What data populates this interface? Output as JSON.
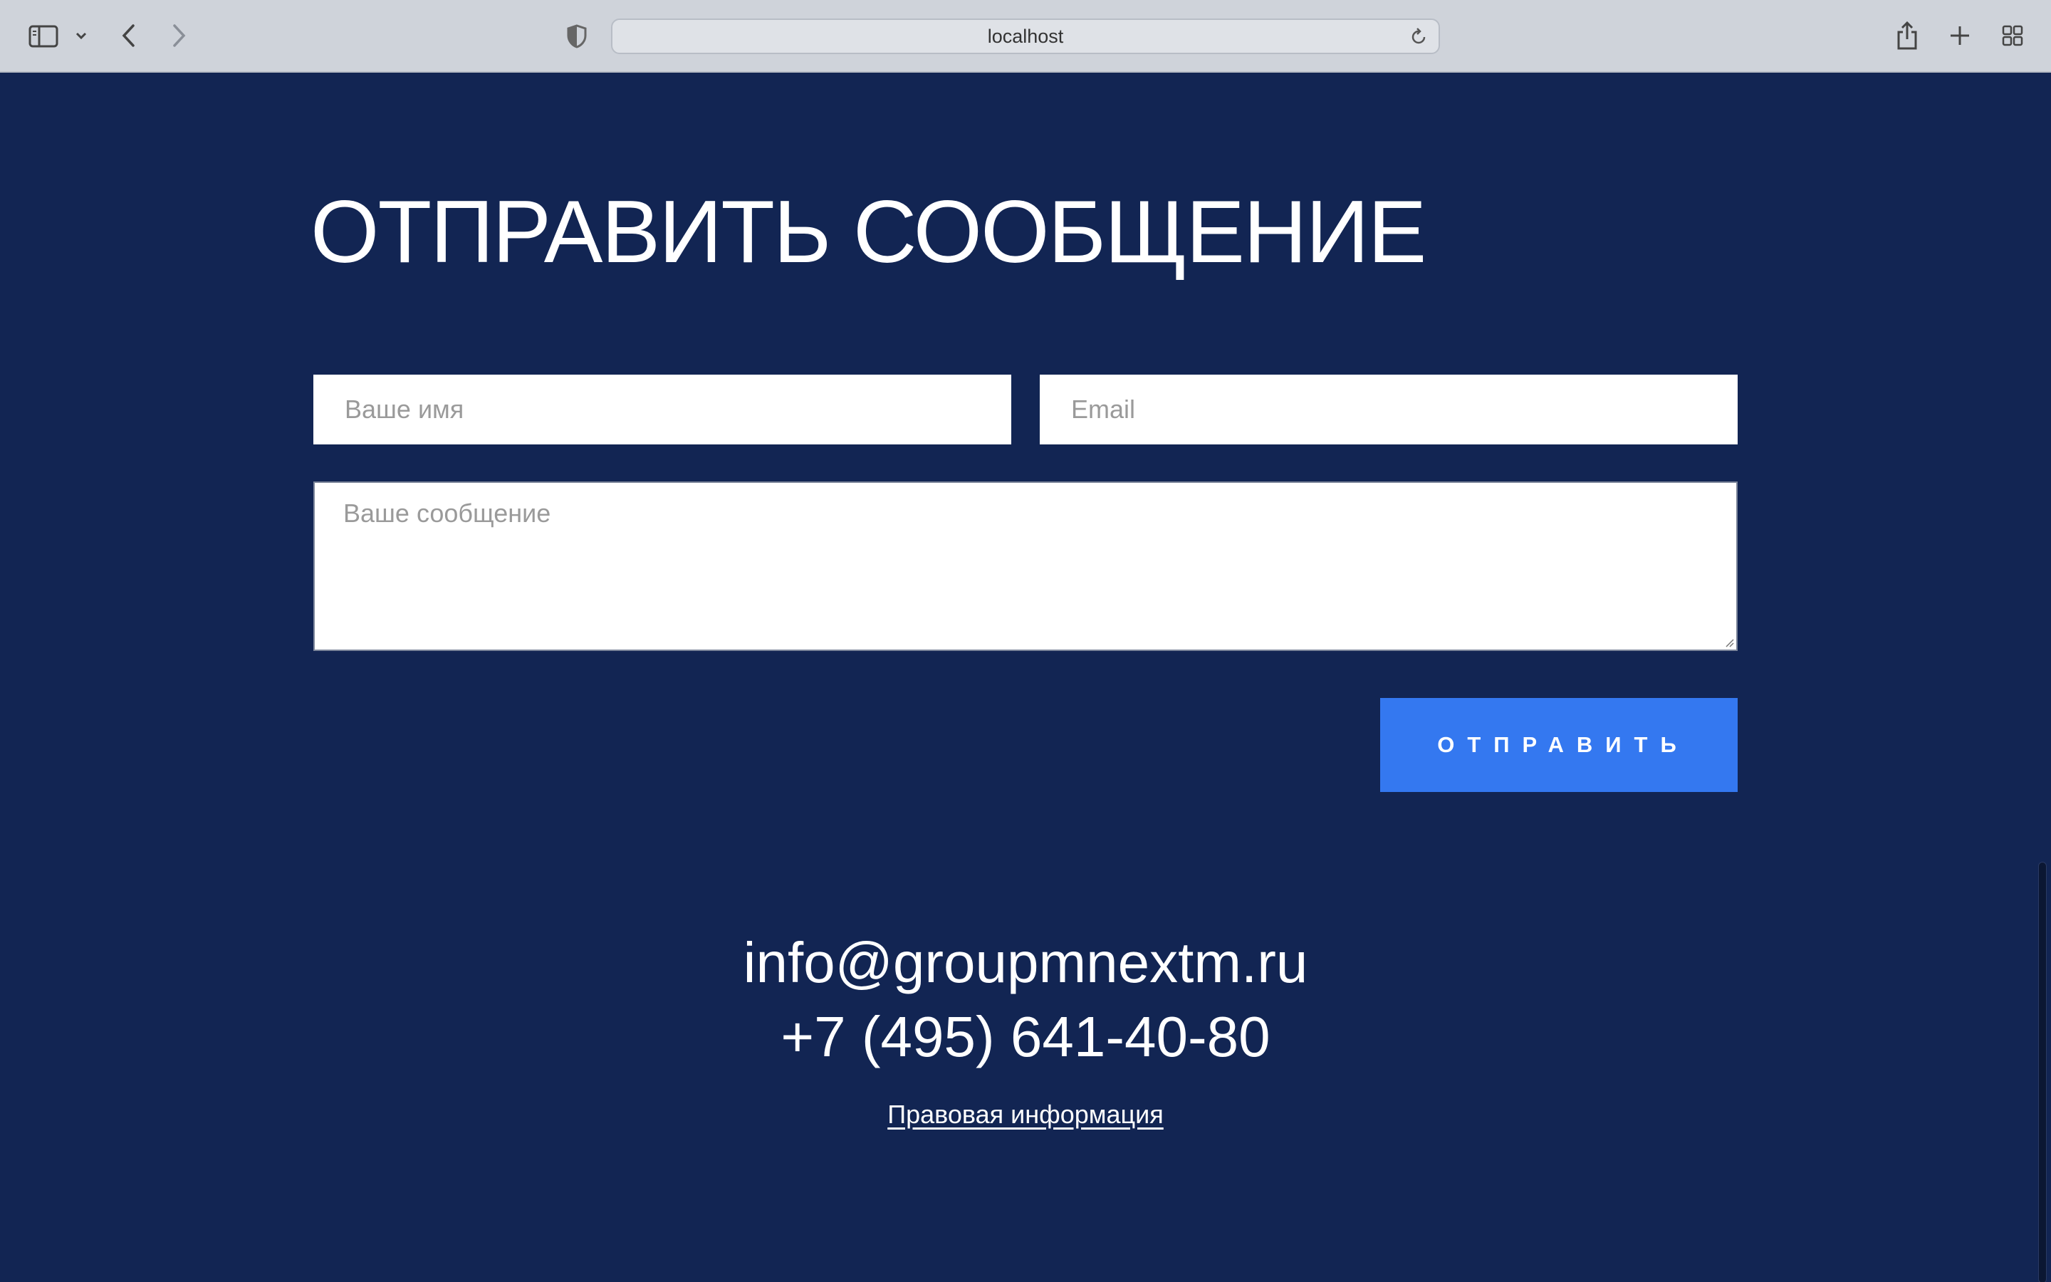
{
  "browser": {
    "url": "localhost",
    "icons": {
      "sidebar": "sidebar-icon",
      "sidebar_menu": "chevron-down-icon",
      "back": "chevron-left-icon",
      "forward": "chevron-right-icon",
      "privacy": "shield-icon",
      "reload": "reload-icon",
      "share": "share-icon",
      "new_tab": "plus-icon",
      "tab_overview": "grid-icon"
    }
  },
  "page": {
    "title": "ОТПРАВИТЬ СООБЩЕНИЕ",
    "form": {
      "name_placeholder": "Ваше имя",
      "name_value": "",
      "email_placeholder": "Email",
      "email_value": "",
      "message_placeholder": "Ваше сообщение",
      "message_value": "",
      "submit_label": "ОТПРАВИТЬ"
    },
    "contacts": {
      "email": "info@groupmnextm.ru",
      "phone": "+7 (495) 641-40-80",
      "legal_link": "Правовая информация"
    }
  },
  "colors": {
    "background": "#122553",
    "button": "#3478f0",
    "toolbar": "#cfd3da",
    "text": "#ffffff"
  }
}
